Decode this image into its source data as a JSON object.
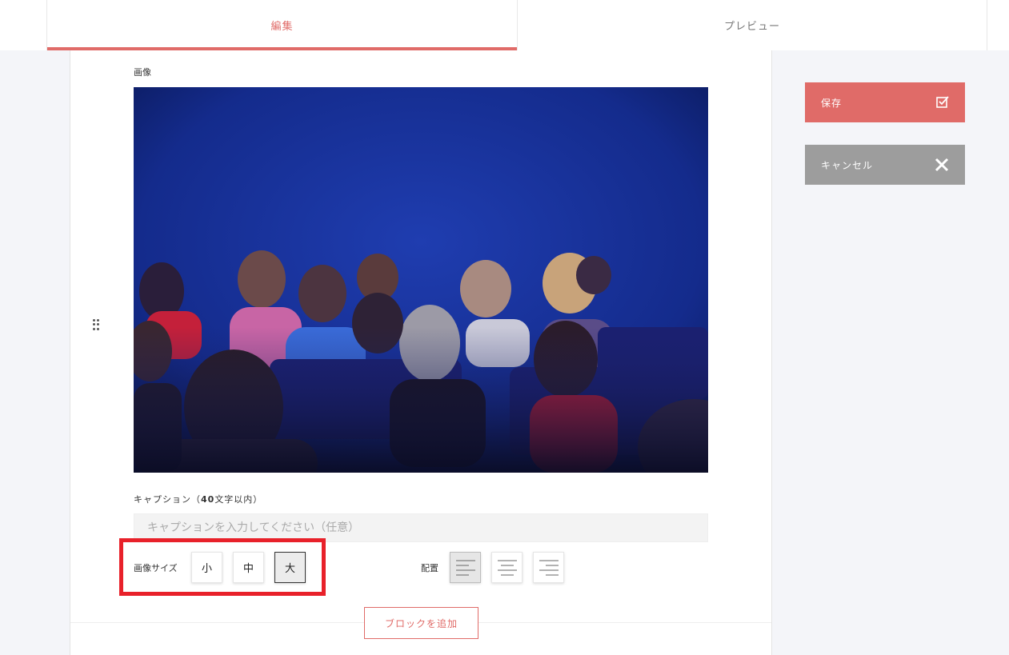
{
  "tabs": {
    "edit": "編集",
    "preview": "プレビュー"
  },
  "editor": {
    "image_label": "画像",
    "caption_label_pre": "キャプション（",
    "caption_label_num": "40",
    "caption_label_post": "文字以内）",
    "caption_placeholder": "キャプションを入力してください（任意）",
    "size_label": "画像サイズ",
    "size_options": [
      "小",
      "中",
      "大"
    ],
    "size_selected": "大",
    "align_label": "配置",
    "align_options": [
      "left-align-icon",
      "center-align-icon",
      "right-align-icon"
    ],
    "align_selected": "left",
    "add_block": "ブロックを追加"
  },
  "actions": {
    "save": "保存",
    "cancel": "キャンセル"
  },
  "colors": {
    "accent": "#e06b68",
    "cancel_bg": "#9d9d9d",
    "highlight": "#e8212a"
  }
}
